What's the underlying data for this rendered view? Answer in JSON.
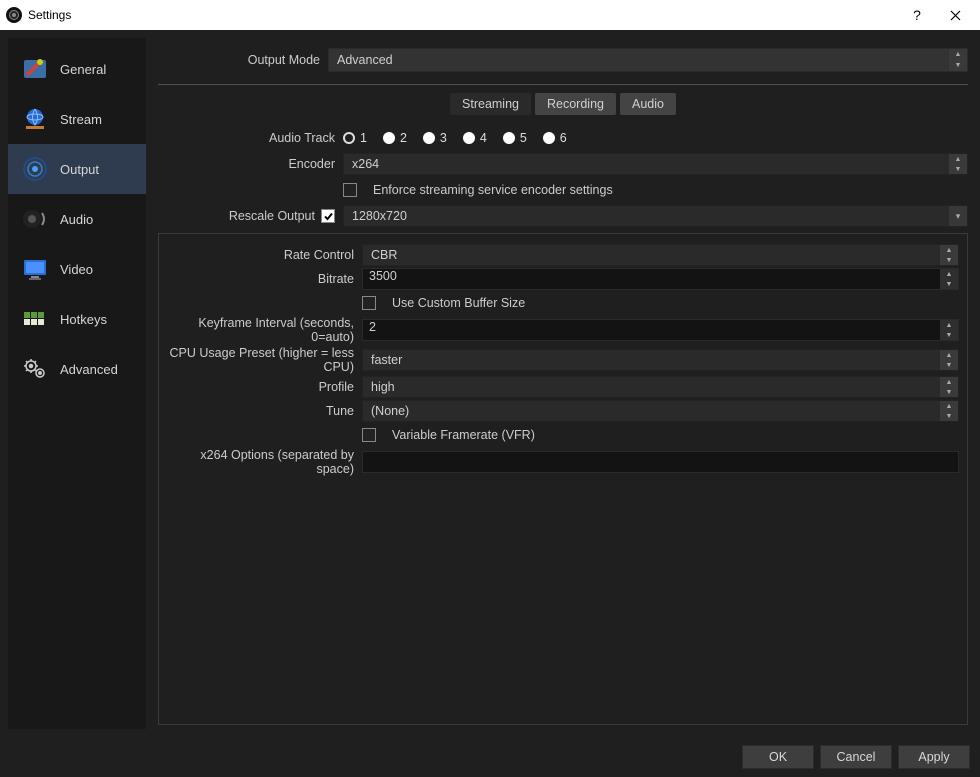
{
  "window": {
    "title": "Settings"
  },
  "sidebar": {
    "items": [
      {
        "label": "General"
      },
      {
        "label": "Stream"
      },
      {
        "label": "Output"
      },
      {
        "label": "Audio"
      },
      {
        "label": "Video"
      },
      {
        "label": "Hotkeys"
      },
      {
        "label": "Advanced"
      }
    ]
  },
  "output_mode": {
    "label": "Output Mode",
    "value": "Advanced"
  },
  "tabs": {
    "streaming": "Streaming",
    "recording": "Recording",
    "audio": "Audio"
  },
  "form": {
    "audio_track_label": "Audio Track",
    "tracks": {
      "t1": "1",
      "t2": "2",
      "t3": "3",
      "t4": "4",
      "t5": "5",
      "t6": "6"
    },
    "encoder_label": "Encoder",
    "encoder_value": "x264",
    "enforce_label": "Enforce streaming service encoder settings",
    "rescale_label": "Rescale Output",
    "rescale_value": "1280x720",
    "rate_control_label": "Rate Control",
    "rate_control_value": "CBR",
    "bitrate_label": "Bitrate",
    "bitrate_value": "3500",
    "custom_buffer_label": "Use Custom Buffer Size",
    "keyframe_label": "Keyframe Interval (seconds, 0=auto)",
    "keyframe_value": "2",
    "cpu_preset_label": "CPU Usage Preset (higher = less CPU)",
    "cpu_preset_value": "faster",
    "profile_label": "Profile",
    "profile_value": "high",
    "tune_label": "Tune",
    "tune_value": "(None)",
    "vfr_label": "Variable Framerate (VFR)",
    "x264opts_label": "x264 Options (separated by space)",
    "x264opts_value": ""
  },
  "footer": {
    "ok": "OK",
    "cancel": "Cancel",
    "apply": "Apply"
  }
}
